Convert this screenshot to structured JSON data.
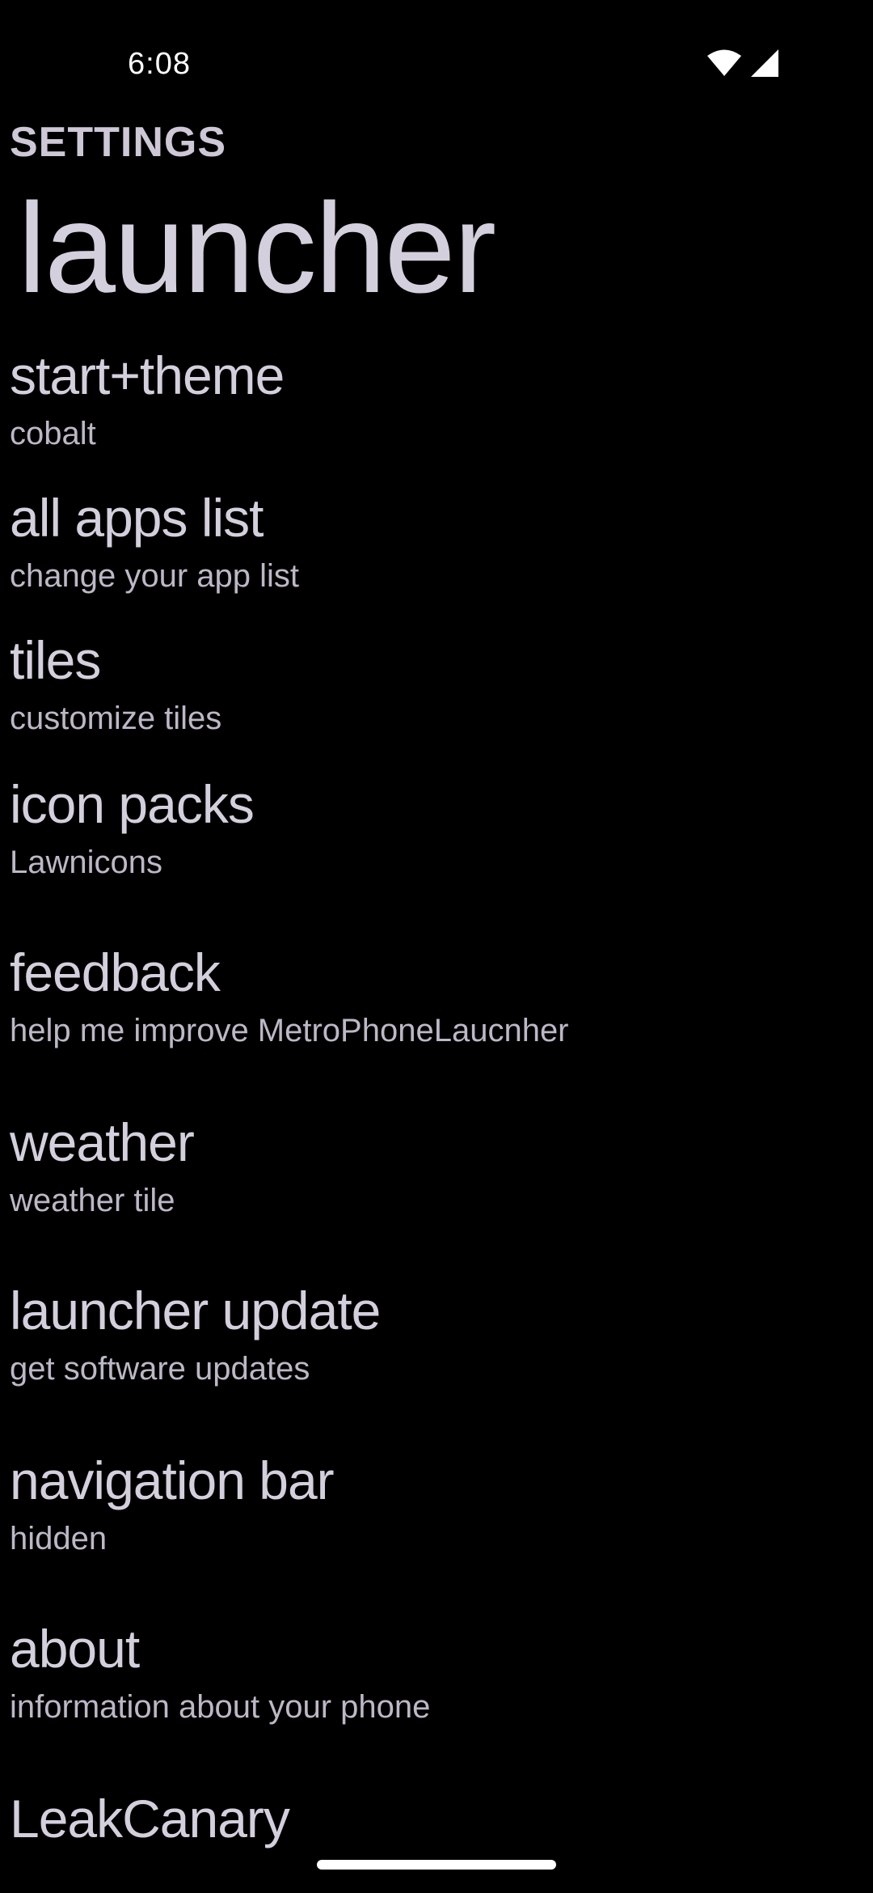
{
  "status_bar": {
    "time": "6:08",
    "icons": [
      "wifi-icon",
      "cellular-signal-icon"
    ]
  },
  "header": {
    "section_label": "SETTINGS",
    "title": "launcher"
  },
  "settings": [
    {
      "title": "start+theme",
      "subtitle": "cobalt"
    },
    {
      "title": "all apps list",
      "subtitle": "change your app list"
    },
    {
      "title": "tiles",
      "subtitle": "customize tiles"
    },
    {
      "title": "icon packs",
      "subtitle": "Lawnicons"
    },
    {
      "title": "feedback",
      "subtitle": "help me improve MetroPhoneLaucnher"
    },
    {
      "title": "weather",
      "subtitle": "weather tile"
    },
    {
      "title": "launcher update",
      "subtitle": "get software updates"
    },
    {
      "title": "navigation bar",
      "subtitle": "hidden"
    },
    {
      "title": "about",
      "subtitle": "information about your phone"
    },
    {
      "title": "LeakCanary",
      "subtitle": ""
    }
  ],
  "colors": {
    "background": "#000000",
    "text": "#d4cfdc",
    "subtext": "#bdb7c6"
  }
}
